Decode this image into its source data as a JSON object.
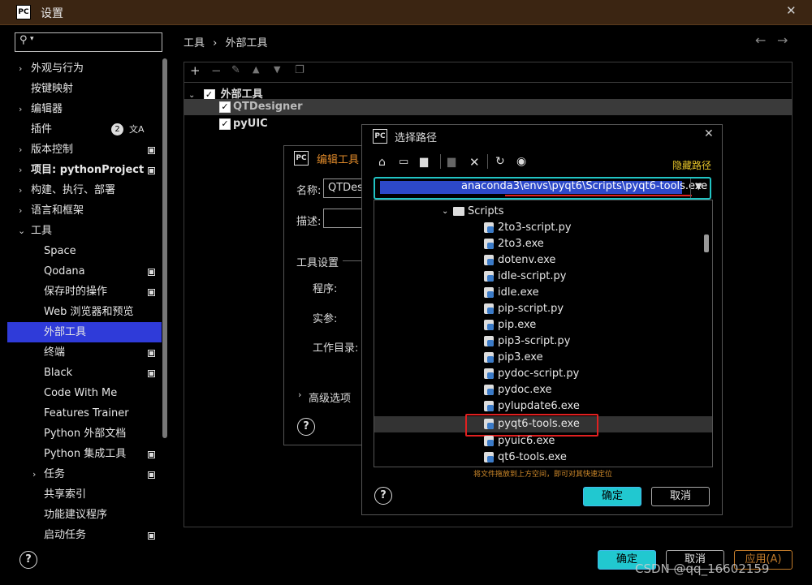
{
  "window": {
    "title": "设置",
    "logo": "PC",
    "close_icon": "✕"
  },
  "search": {
    "placeholder": ""
  },
  "sidebar": {
    "items": [
      {
        "label": "外观与行为",
        "arrow": "›",
        "badge": ""
      },
      {
        "label": "按键映射",
        "arrow": "",
        "badge": ""
      },
      {
        "label": "编辑器",
        "arrow": "›",
        "badge": ""
      },
      {
        "label": "插件",
        "arrow": "",
        "badge": "2"
      },
      {
        "label": "版本控制",
        "arrow": "›",
        "badge": ""
      },
      {
        "label": "项目: pythonProject",
        "arrow": "›",
        "badge": ""
      },
      {
        "label": "构建、执行、部署",
        "arrow": "›",
        "badge": ""
      },
      {
        "label": "语言和框架",
        "arrow": "›",
        "badge": ""
      },
      {
        "label": "工具",
        "arrow": "⌄",
        "badge": ""
      },
      {
        "label": "Space",
        "arrow": "",
        "badge": ""
      },
      {
        "label": "Qodana",
        "arrow": "",
        "badge": ""
      },
      {
        "label": "保存时的操作",
        "arrow": "",
        "badge": ""
      },
      {
        "label": "Web 浏览器和预览",
        "arrow": "",
        "badge": ""
      },
      {
        "label": "外部工具",
        "arrow": "",
        "badge": ""
      },
      {
        "label": "终端",
        "arrow": "",
        "badge": ""
      },
      {
        "label": "Black",
        "arrow": "",
        "badge": ""
      },
      {
        "label": "Code With Me",
        "arrow": "",
        "badge": ""
      },
      {
        "label": "Features Trainer",
        "arrow": "",
        "badge": ""
      },
      {
        "label": "Python 外部文档",
        "arrow": "",
        "badge": ""
      },
      {
        "label": "Python 集成工具",
        "arrow": "",
        "badge": ""
      },
      {
        "label": "任务",
        "arrow": "›",
        "badge": ""
      },
      {
        "label": "共享索引",
        "arrow": "",
        "badge": ""
      },
      {
        "label": "功能建议程序",
        "arrow": "",
        "badge": ""
      },
      {
        "label": "启动任务",
        "arrow": "",
        "badge": ""
      }
    ]
  },
  "breadcrumb": {
    "root": "工具",
    "sep": "›",
    "current": "外部工具"
  },
  "tools_tree": {
    "group": "外部工具",
    "items": [
      "QTDesigner",
      "pyUIC"
    ]
  },
  "edit_dialog": {
    "title": "编辑工具",
    "name_label": "名称:",
    "name_value": "QTDesi",
    "desc_label": "描述:",
    "settings_label": "工具设置",
    "program_label": "程序:",
    "args_label": "实参:",
    "workdir_label": "工作目录:",
    "advanced_label": "高级选项"
  },
  "path_dialog": {
    "title": "选择路径",
    "hide_path": "隐藏路径",
    "path_value": "anaconda3\\envs\\pyqt6\\Scripts\\pyqt6-tools.exe",
    "folder": "Scripts",
    "files": [
      "2to3-script.py",
      "2to3.exe",
      "dotenv.exe",
      "idle-script.py",
      "idle.exe",
      "pip-script.py",
      "pip.exe",
      "pip3-script.py",
      "pip3.exe",
      "pydoc-script.py",
      "pydoc.exe",
      "pylupdate6.exe",
      "pyqt6-tools.exe",
      "pyuic6.exe",
      "qt6-tools.exe"
    ],
    "hint": "将文件拖放到上方空间，即可对其快速定位",
    "ok": "确定",
    "cancel": "取消"
  },
  "footer": {
    "ok": "确定",
    "cancel": "取消",
    "apply": "应用(A)",
    "watermark": "CSDN @qq_16602159"
  },
  "colors": {
    "titlebar": "#3b2512",
    "selection": "#2f3bd9",
    "accent": "#21c8d0",
    "highlight_red": "#e02020"
  }
}
